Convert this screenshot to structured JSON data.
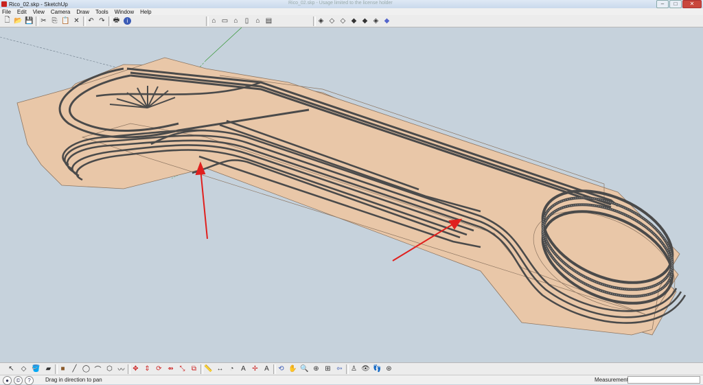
{
  "window": {
    "title": "Rico_02.skp - SketchUp",
    "center_caption": "Rico_02.skp - Usage limited to the license holder"
  },
  "menu": [
    "File",
    "Edit",
    "View",
    "Camera",
    "Draw",
    "Tools",
    "Window",
    "Help"
  ],
  "toolbar": {
    "icons": [
      "new-file-icon",
      "open-file-icon",
      "save-icon",
      "cut-icon",
      "copy-icon",
      "paste-icon",
      "erase-icon",
      "undo-icon",
      "redo-icon",
      "print-icon",
      "model-info-icon"
    ],
    "views": [
      "iso-view-icon",
      "top-view-icon",
      "front-view-icon",
      "right-view-icon",
      "back-view-icon",
      "left-view-icon"
    ],
    "styles": [
      "xray-style-icon",
      "wireframe-style-icon",
      "hidden-line-style-icon",
      "shaded-style-icon",
      "shaded-textures-style-icon",
      "monochrome-style-icon"
    ]
  },
  "bottom_tools": [
    "select",
    "make-component",
    "paint-bucket",
    "eraser",
    "rectangle",
    "line",
    "circle",
    "arc",
    "polygon",
    "freehand",
    "move",
    "push-pull",
    "rotate",
    "follow-me",
    "scale",
    "offset",
    "tape-measure",
    "dimension",
    "protractor",
    "text",
    "axes",
    "3d-text",
    "orbit",
    "pan",
    "zoom",
    "zoom-window",
    "zoom-extents",
    "previous",
    "position-camera",
    "look-around",
    "walk",
    "section-plane"
  ],
  "status": {
    "hint": "Drag in direction to pan",
    "measurements_label": "Measurements",
    "measurements_value": ""
  },
  "colors": {
    "sky": "#c6d2dc",
    "board": "#e9c7a8",
    "board_edge": "#8c7561",
    "track": "#4a4a4a",
    "arrow": "#e0201e"
  }
}
